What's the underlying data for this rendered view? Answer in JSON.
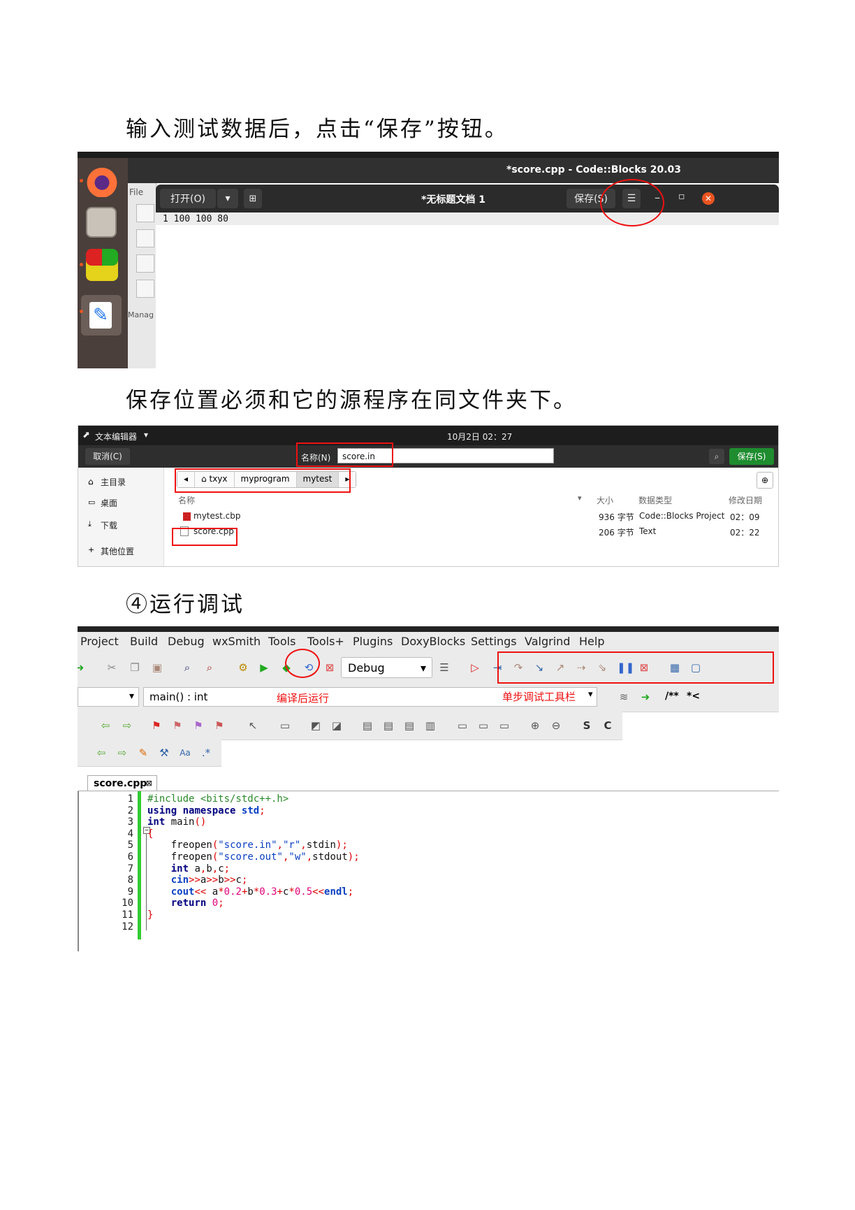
{
  "instructions": {
    "step_save": "输入测试数据后，点击“保存”按钮。",
    "step_location": "保存位置必须和它的源程序在同文件夹下。",
    "step_run": "④运行调试"
  },
  "shot1": {
    "codeblocks_title": "*score.cpp - Code::Blocks 20.03",
    "side_labels": [
      "File",
      "Manag"
    ],
    "gedit": {
      "open_button": "打开(O)",
      "doc_title": "*无标题文档 1",
      "save_button": "保存(S)",
      "line_text": "1 100  100  80"
    }
  },
  "shot2": {
    "app_menu": "文本编辑器",
    "clock": "10月2日  02：27",
    "cancel_button": "取消(C)",
    "name_label": "名称(N)",
    "name_value": "score.in",
    "save_button": "保存(S)",
    "sidebar": [
      "主目录",
      "桌面",
      "下载",
      "其他位置"
    ],
    "path": [
      "txyx",
      "myprogram",
      "mytest"
    ],
    "columns": {
      "name": "名称",
      "size": "大小",
      "type": "数据类型",
      "modified": "修改日期"
    },
    "files": [
      {
        "name": "mytest.cbp",
        "size": "936 字节",
        "type": "Code::Blocks Project",
        "modified": "02：09"
      },
      {
        "name": "score.cpp",
        "size": "206 字节",
        "type": "Text",
        "modified": "02：22"
      }
    ]
  },
  "shot3": {
    "menu": [
      "Project",
      "Build",
      "Debug",
      "wxSmith",
      "Tools",
      "Tools+",
      "Plugins",
      "DoxyBlocks",
      "Settings",
      "Valgrind",
      "Help"
    ],
    "build_target": "Debug",
    "function_scope": "main() : int",
    "annotation_build_run": "编译后运行",
    "annotation_debug_toolbar": "单步调试工具栏",
    "doc_buttons": [
      "/**",
      "*<"
    ],
    "file_tab": "score.cpp",
    "code_lines": [
      "#include <bits/stdc++.h>",
      "using namespace std;",
      "int main()",
      "{",
      "    freopen(\"score.in\",\"r\",stdin);",
      "    freopen(\"score.out\",\"w\",stdout);",
      "    int a,b,c;",
      "    cin>>a>>b>>c;",
      "    cout<< a*0.2+b*0.3+c*0.5<<endl;",
      "    return 0;",
      "}",
      ""
    ],
    "line_numbers": [
      "1",
      "2",
      "3",
      "4",
      "5",
      "6",
      "7",
      "8",
      "9",
      "10",
      "11",
      "12"
    ]
  }
}
